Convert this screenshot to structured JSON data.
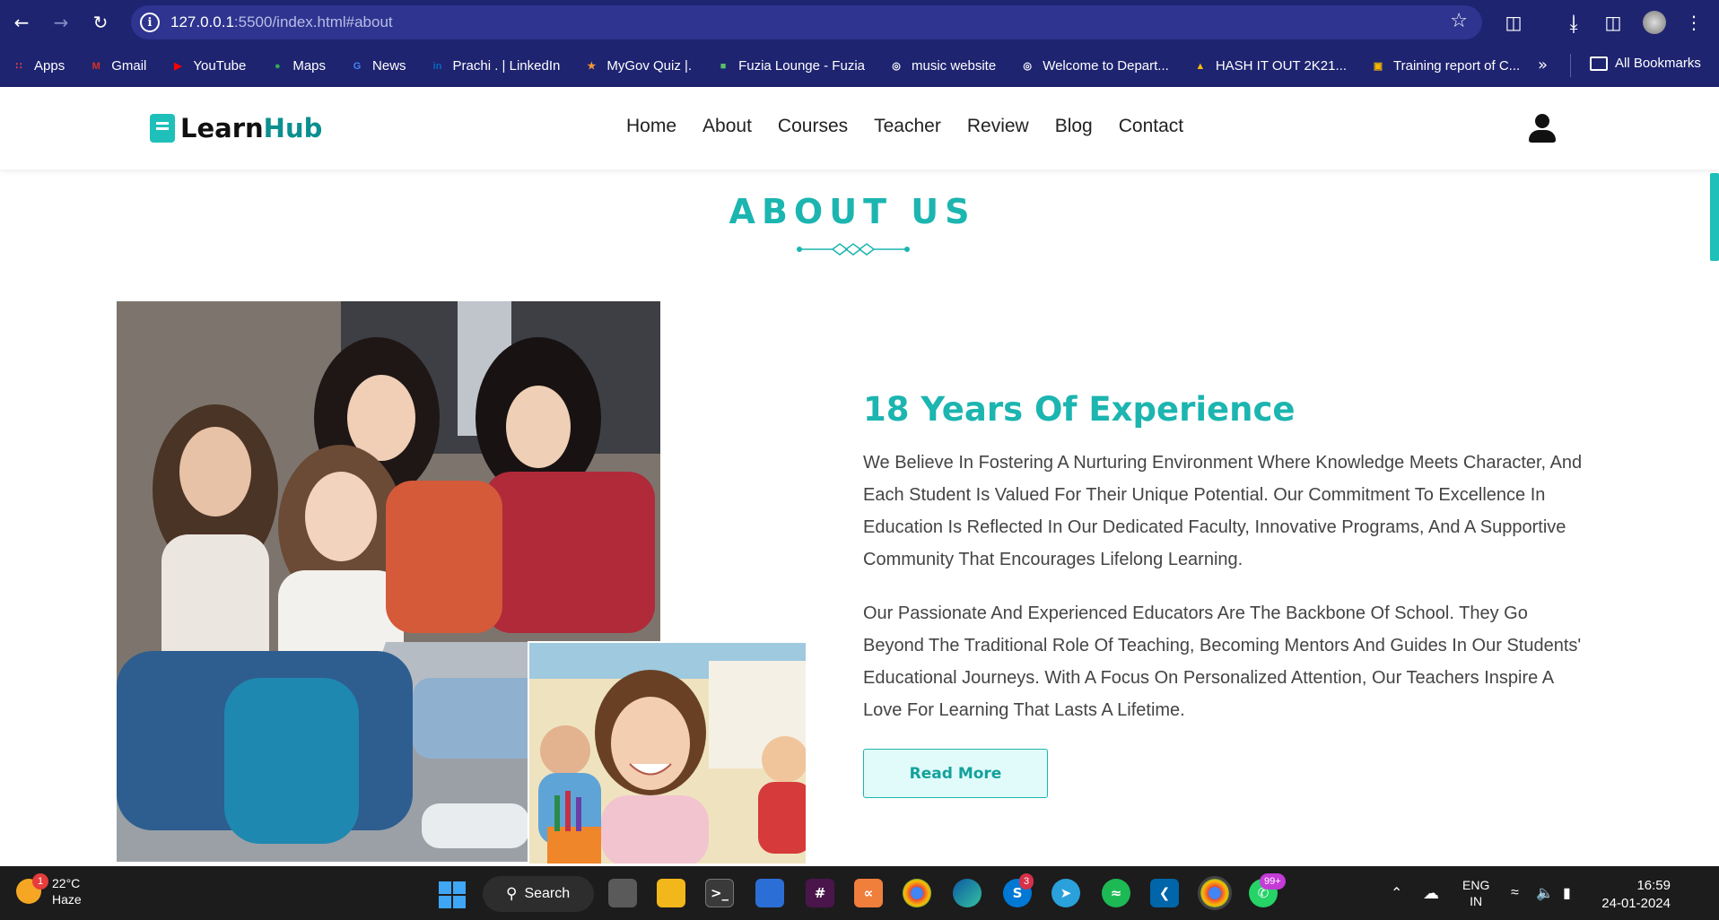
{
  "browser": {
    "url_host": "127.0.0.1",
    "url_rest": ":5500/index.html#about",
    "bookmarks": [
      {
        "label": "Apps",
        "icon": "apps-grid-icon",
        "color": "#e8453c"
      },
      {
        "label": "Gmail",
        "icon": "gmail-icon",
        "color": "#d93025"
      },
      {
        "label": "YouTube",
        "icon": "youtube-icon",
        "color": "#ff0000"
      },
      {
        "label": "Maps",
        "icon": "maps-pin-icon",
        "color": "#34a853"
      },
      {
        "label": "News",
        "icon": "google-news-icon",
        "color": "#4285f4"
      },
      {
        "label": "Prachi . | LinkedIn",
        "icon": "linkedin-icon",
        "color": "#0a66c2"
      },
      {
        "label": "MyGov Quiz |.",
        "icon": "mygov-icon",
        "color": "#f09a36"
      },
      {
        "label": "Fuzia Lounge - Fuzia",
        "icon": "fuzia-icon",
        "color": "#5bbf6a"
      },
      {
        "label": "music website",
        "icon": "globe-icon",
        "color": "#ffffff"
      },
      {
        "label": "Welcome to Depart...",
        "icon": "globe-icon",
        "color": "#ffffff"
      },
      {
        "label": "HASH IT OUT 2K21...",
        "icon": "google-drive-icon",
        "color": "#fbbc04"
      },
      {
        "label": "Training report of C...",
        "icon": "slides-icon",
        "color": "#f4b400"
      }
    ],
    "all_bookmarks": "All Bookmarks"
  },
  "site": {
    "logo_learn": "Learn",
    "logo_hub": "Hub",
    "menu": [
      "Home",
      "About",
      "Courses",
      "Teacher",
      "Review",
      "Blog",
      "Contact"
    ]
  },
  "about": {
    "section_title": "ABOUT US",
    "heading": "18 Years Of Experience",
    "paragraph1": "We Believe In Fostering A Nurturing Environment Where Knowledge Meets Character, And Each Student Is Valued For Their Unique Potential. Our Commitment To Excellence In Education Is Reflected In Our Dedicated Faculty, Innovative Programs, And A Supportive Community That Encourages Lifelong Learning.",
    "paragraph2": "Our Passionate And Experienced Educators Are The Backbone Of School. They Go Beyond The Traditional Role Of Teaching, Becoming Mentors And Guides In Our Students' Educational Journeys. With A Focus On Personalized Attention, Our Teachers Inspire A Love For Learning That Lasts A Lifetime.",
    "read_more": "Read More"
  },
  "taskbar": {
    "weather_badge": "1",
    "temperature": "22°C",
    "condition": "Haze",
    "search_label": "Search",
    "skype_badge": "3",
    "whatsapp_badge": "99+",
    "lang_line1": "ENG",
    "lang_line2": "IN",
    "time": "16:59",
    "date": "24-01-2024"
  },
  "colors": {
    "accent": "#1cb5b0",
    "chrome_bg": "#1e2470"
  }
}
